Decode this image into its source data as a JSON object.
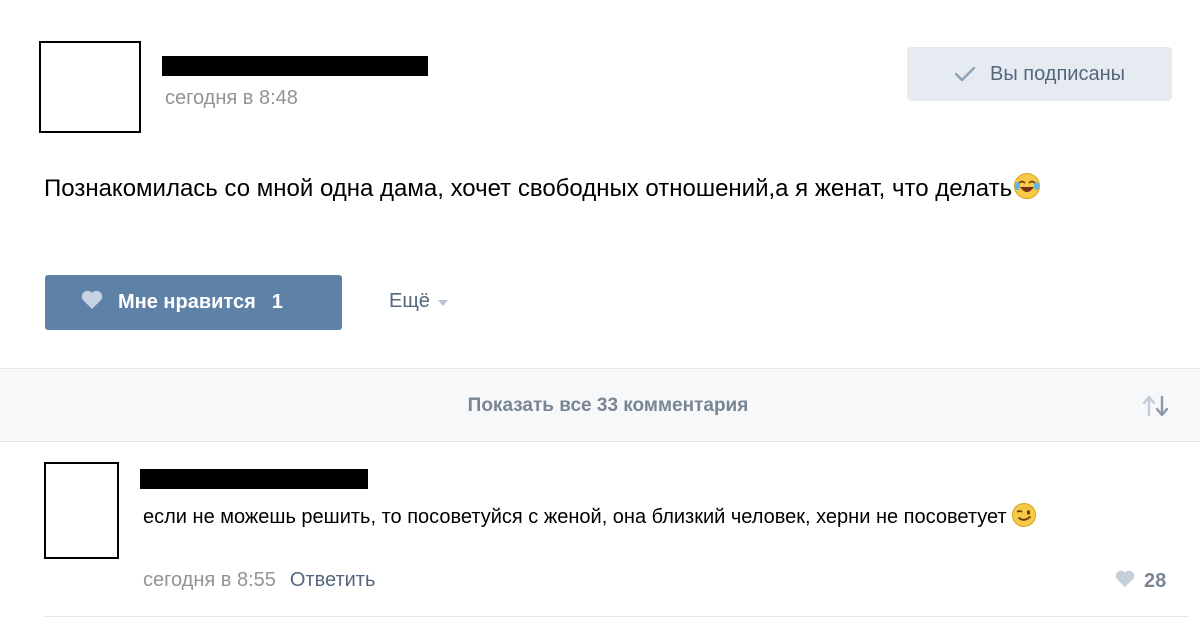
{
  "post": {
    "date": "сегодня в 8:48",
    "subscribe_button": "Вы подписаны",
    "text": "Познакомилась со мной одна дама, хочет свободных отношений,а я женат, что делать",
    "like_label": "Мне нравится",
    "like_count": "1",
    "more_label": "Ещё",
    "icons": {
      "check": "check-icon",
      "heart": "heart-icon",
      "emoji": "laughing-tears-emoji"
    }
  },
  "comments_bar": {
    "label": "Показать все 33 комментария",
    "sort_icon": "sort-arrows-icon"
  },
  "comment": {
    "text": "если не можешь решить, то посоветуйся с женой, она близкий человек, херни не посоветует",
    "date": "сегодня в 8:55",
    "reply_label": "Ответить",
    "like_count": "28",
    "icons": {
      "heart": "heart-icon",
      "emoji": "winking-face-emoji"
    }
  },
  "colors": {
    "accent_button": "#5e81a8",
    "subscribed_bg": "#e5ebf1",
    "link": "#55677d",
    "muted": "#939393",
    "bar_bg": "#f7f8fa"
  }
}
